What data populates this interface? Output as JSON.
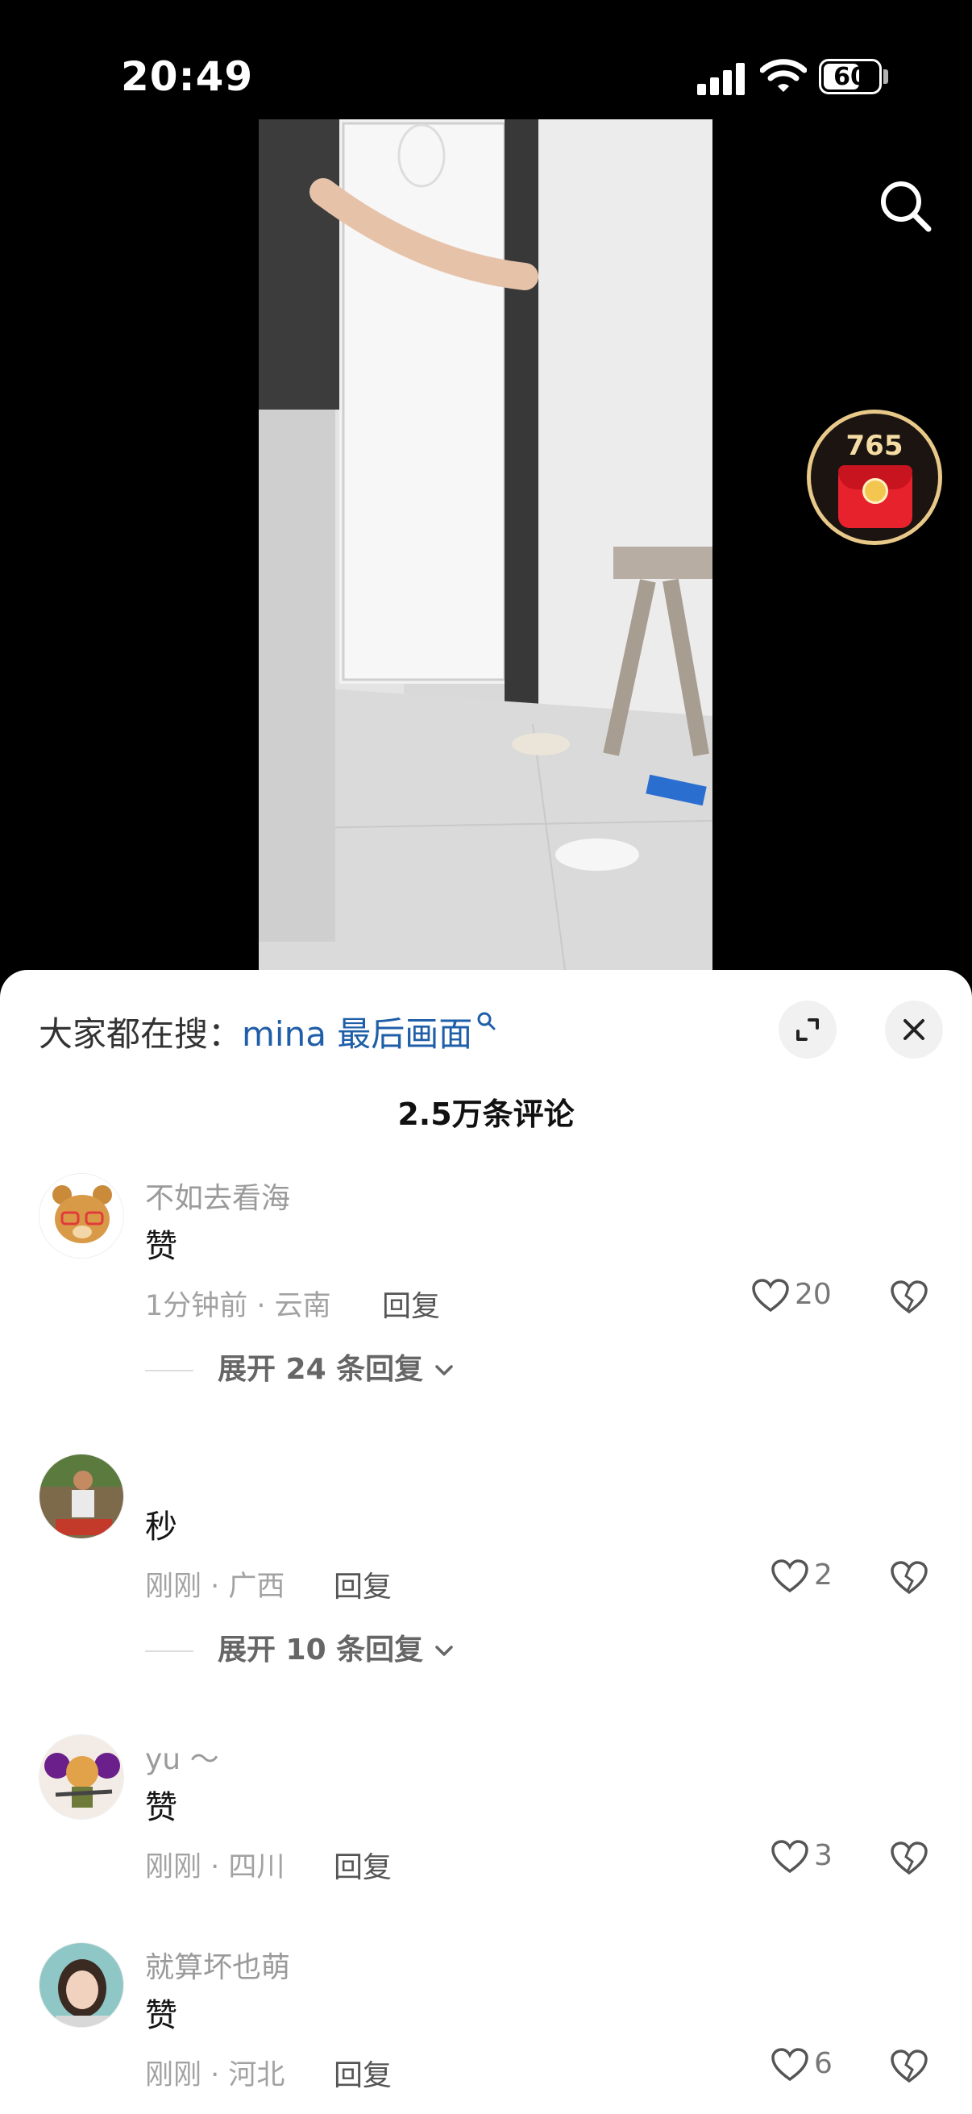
{
  "status": {
    "time": "20:49",
    "battery": "60"
  },
  "redpacket": {
    "count": "765"
  },
  "sheet": {
    "hot_prefix": "大家都在搜：",
    "hot_keyword": "mina 最后画面",
    "comment_count": "2.5万条评论",
    "reply_label": "回复"
  },
  "comments": [
    {
      "username": "不如去看海",
      "text": "赞",
      "meta": "1分钟前 · 云南",
      "likes": "20",
      "expand": "展开 24 条回复"
    },
    {
      "username": "",
      "text": "秒",
      "meta": "刚刚 · 广西",
      "likes": "2",
      "expand": "展开 10 条回复"
    },
    {
      "username": "yu ～",
      "text": "赞",
      "meta": "刚刚 · 四川",
      "likes": "3"
    },
    {
      "username": "就算坏也萌",
      "text": "赞",
      "meta": "刚刚 · 河北",
      "likes": "6"
    }
  ],
  "colors": {
    "keyword": "#1f5ea8",
    "redpacket_ring": "#e8c98a",
    "envelope": "#e8222c"
  }
}
